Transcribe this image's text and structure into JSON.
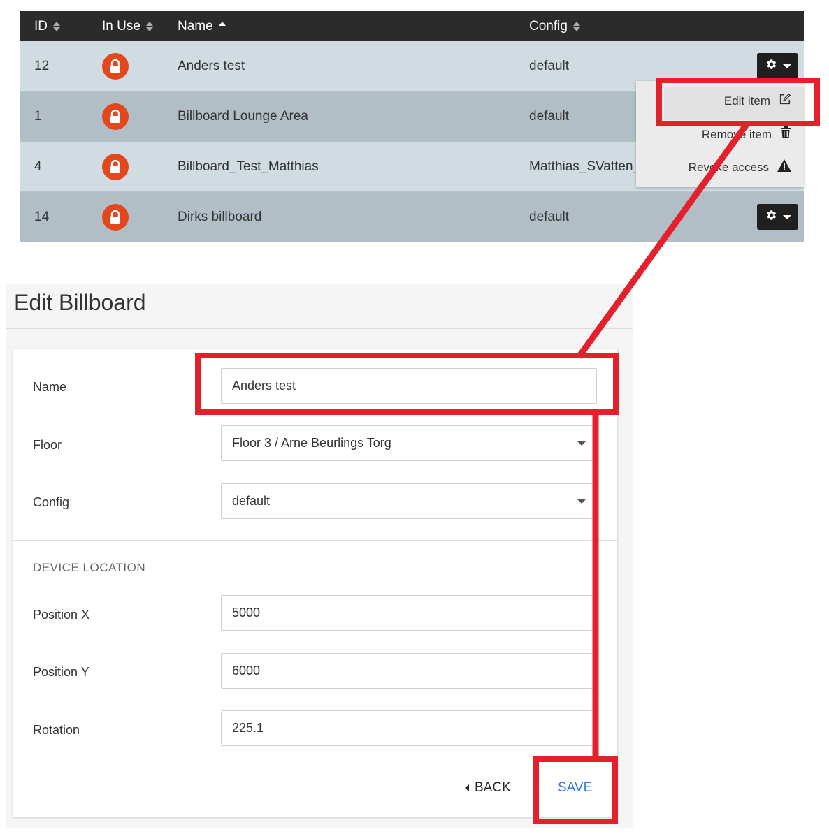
{
  "table": {
    "headers": [
      {
        "label": "ID",
        "sort": "both"
      },
      {
        "label": "In Use",
        "sort": "both"
      },
      {
        "label": "Name",
        "sort": "asc"
      },
      {
        "label": "Config",
        "sort": "both"
      }
    ],
    "rows": [
      {
        "id": "12",
        "name": "Anders test",
        "config": "default",
        "locked": true,
        "actions": true
      },
      {
        "id": "1",
        "name": "Billboard Lounge Area",
        "config": "default",
        "locked": true,
        "actions": false
      },
      {
        "id": "4",
        "name": "Billboard_Test_Matthias",
        "config": "Matthias_SVatten_",
        "locked": true,
        "actions": false
      },
      {
        "id": "14",
        "name": "Dirks billboard",
        "config": "default",
        "locked": true,
        "actions": true
      }
    ]
  },
  "menu": {
    "items": [
      {
        "label": "Edit item",
        "icon": "edit-icon"
      },
      {
        "label": "Remove item",
        "icon": "trash-icon"
      },
      {
        "label": "Revoke access",
        "icon": "warning-icon"
      }
    ]
  },
  "form": {
    "title": "Edit Billboard",
    "name_label": "Name",
    "name_value": "Anders test",
    "floor_label": "Floor",
    "floor_value": "Floor 3 / Arne Beurlings Torg",
    "config_label": "Config",
    "config_value": "default",
    "section_title": "DEVICE LOCATION",
    "posx_label": "Position X",
    "posx_value": "5000",
    "posy_label": "Position Y",
    "posy_value": "6000",
    "rotation_label": "Rotation",
    "rotation_value": "225.1",
    "back_label": "BACK",
    "save_label": "SAVE"
  },
  "colors": {
    "header_bg": "#2b2b2b",
    "row_light": "#d0dce2",
    "row_dark": "#b1bec6",
    "lock_badge": "#e2471d",
    "annotation": "#e3202c",
    "save_link": "#2f7de1"
  }
}
